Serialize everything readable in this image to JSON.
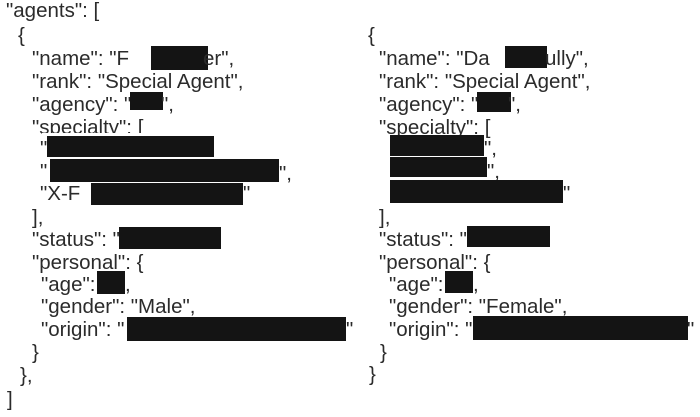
{
  "document": {
    "redaction_color": "#141414",
    "left": {
      "open_key": "\"agents\": [",
      "open_brace": "{",
      "name_prefix": "\"name\": \"F",
      "name_suffix": "er\",",
      "rank": "\"rank\": \"Special Agent\",",
      "agency_prefix": "\"agency\": \"",
      "agency_suffix": "\",",
      "specialty_open": "\"specialty\": [",
      "spec_q1": "\"",
      "spec_q2": "\"",
      "spec_end2": "\",",
      "spec_prefix3": "\"X-F",
      "spec_end3": "\"",
      "specialty_close": "],",
      "status_prefix": "\"status\": \"",
      "personal_open": "\"personal\": {",
      "age_prefix": "\"age\":",
      "age_suffix": ",",
      "gender": "\"gender\": \"Male\",",
      "origin_prefix": "\"origin\": \"",
      "origin_suffix": "\"",
      "inner_close": "}",
      "outer_close": "},",
      "array_close": "]"
    },
    "right": {
      "open_brace": "{",
      "name_prefix": "\"name\": \"Da",
      "name_suffix": "ully\",",
      "rank": "\"rank\": \"Special Agent\",",
      "agency_prefix": "\"agency\": \"",
      "agency_suffix": "\",",
      "specialty_open": "\"specialty\": [",
      "spec_end1": "\",",
      "spec_end2": "\",",
      "spec_end3": "\"",
      "specialty_close": "],",
      "status_prefix": "\"status\": \"",
      "personal_open": "\"personal\": {",
      "age_prefix": "\"age\":",
      "age_suffix": ",",
      "gender": "\"gender\": \"Female\",",
      "origin_prefix": "\"origin\": \"",
      "origin_suffix": "\"",
      "inner_close": "}",
      "outer_close": "}"
    }
  }
}
